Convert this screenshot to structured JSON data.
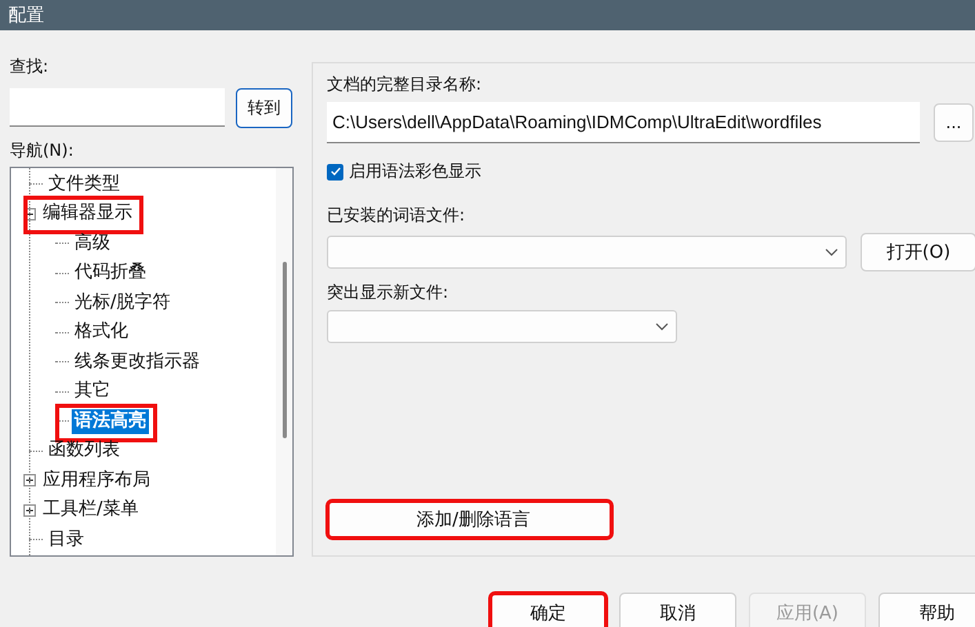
{
  "window": {
    "title": "配置"
  },
  "find": {
    "label": "查找:",
    "button": "转到"
  },
  "navigation": {
    "label": "导航(N):",
    "items": [
      {
        "label": "文件类型",
        "selected": false,
        "highlighted": false
      },
      {
        "label": "编辑器显示",
        "selected": false,
        "highlighted": true,
        "expanded": true,
        "has_children": true,
        "children": [
          {
            "label": "高级",
            "selected": false,
            "highlighted": false
          },
          {
            "label": "代码折叠",
            "selected": false,
            "highlighted": false
          },
          {
            "label": "光标/脱字符",
            "selected": false,
            "highlighted": false
          },
          {
            "label": "格式化",
            "selected": false,
            "highlighted": false
          },
          {
            "label": "线条更改指示器",
            "selected": false,
            "highlighted": false
          },
          {
            "label": "其它",
            "selected": false,
            "highlighted": false
          },
          {
            "label": "语法高亮",
            "selected": true,
            "highlighted": true
          }
        ]
      },
      {
        "label": "函数列表",
        "selected": false,
        "highlighted": false
      },
      {
        "label": "应用程序布局",
        "selected": false,
        "highlighted": false,
        "expanded": false,
        "has_children": true
      },
      {
        "label": "工具栏/菜单",
        "selected": false,
        "highlighted": false,
        "expanded": false,
        "has_children": true
      },
      {
        "label": "目录",
        "selected": false,
        "highlighted": false
      }
    ]
  },
  "settings": {
    "path_label": "文档的完整目录名称:",
    "path_value": "C:\\Users\\dell\\AppData\\Roaming\\IDMComp\\UltraEdit\\wordfiles",
    "browse_button": "...",
    "syntax_coloring": {
      "label": "启用语法彩色显示",
      "checked": true
    },
    "installed_label": "已安装的词语文件:",
    "open_button": "打开(O)",
    "highlight_new_label": "突出显示新文件:",
    "add_remove_button": {
      "label": "添加/删除语言",
      "highlighted": true
    }
  },
  "buttons": [
    {
      "label": "确定",
      "disabled": false,
      "highlighted": true,
      "default": true
    },
    {
      "label": "取消",
      "disabled": false,
      "highlighted": false,
      "default": false
    },
    {
      "label": "应用(A)",
      "disabled": true,
      "highlighted": false,
      "default": false
    },
    {
      "label": "帮助",
      "disabled": false,
      "highlighted": false,
      "default": false
    }
  ]
}
